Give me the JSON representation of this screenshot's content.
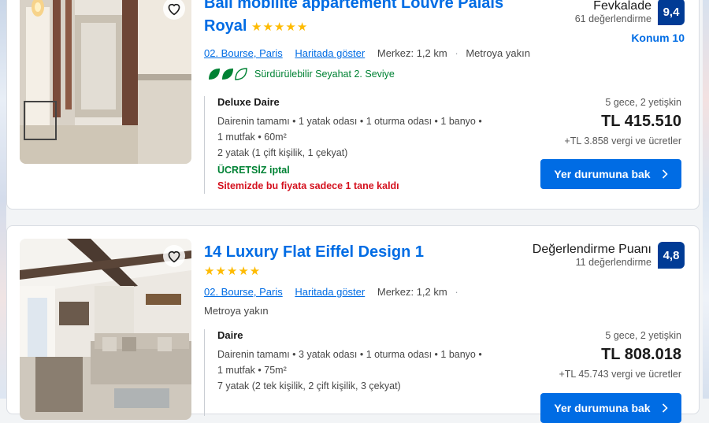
{
  "listings": [
    {
      "title": "Bail mobilité appartement Louvre Palais Royal",
      "stars": "★★★★★",
      "district": "02. Bourse, Paris",
      "map_link": "Haritada göster",
      "center_distance": "Merkez: 1,2 km",
      "metro": "Metroya yakın",
      "sustainability": "Sürdürülebilir Seyahat 2. Seviye",
      "rating_word": "Fevkalade",
      "review_count": "61 değerlendirme",
      "score": "9,4",
      "location_score": "Konum 10",
      "room_name": "Deluxe Daire",
      "room_desc_1": "Dairenin tamamı • 1 yatak odası • 1 oturma odası • 1 banyo •",
      "room_desc_2": "1 mutfak • 60m²",
      "beds": "2 yatak (1 çift kişilik, 1 çekyat)",
      "free_cancel": "ÜCRETSİZ iptal",
      "scarcity": "Sitemizde bu fiyata sadece 1 tane kaldı",
      "stay": "5 gece, 2 yetişkin",
      "price": "TL 415.510",
      "taxes": "+TL 3.858 vergi ve ücretler",
      "cta": "Yer durumuna bak"
    },
    {
      "title": "14 Luxury Flat Eiffel Design 1",
      "stars": "★★★★★",
      "district": "02. Bourse, Paris",
      "map_link": "Haritada göster",
      "center_distance": "Merkez: 1,2 km",
      "metro": "Metroya yakın",
      "rating_word": "Değerlendirme Puanı",
      "review_count": "11 değerlendirme",
      "score": "4,8",
      "room_name": "Daire",
      "room_desc_1": "Dairenin tamamı • 3 yatak odası • 1 oturma odası • 1 banyo •",
      "room_desc_2": "1 mutfak • 75m²",
      "beds": "7 yatak (2 tek kişilik, 2 çift kişilik, 3 çekyat)",
      "stay": "5 gece, 2 yetişkin",
      "price": "TL 808.018",
      "taxes": "+TL 45.743 vergi ve ücretler",
      "cta": "Yer durumuna bak"
    }
  ],
  "icons": {
    "favorite": "heart-icon",
    "sustainability": "leaf-icon",
    "cta_arrow": "chevron-right-icon"
  },
  "colors": {
    "link": "#006ce4",
    "score_bg": "#003b95",
    "stars": "#febb02",
    "green": "#008234",
    "red": "#d4111e"
  }
}
